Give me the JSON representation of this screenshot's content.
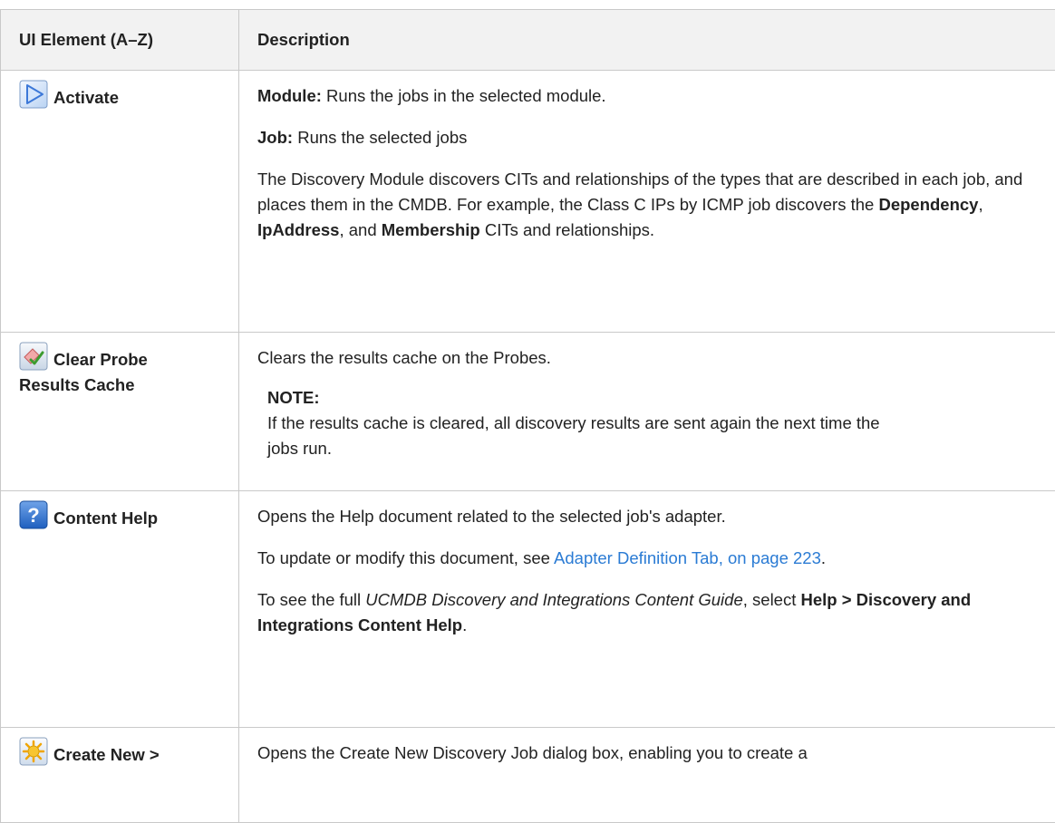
{
  "header": {
    "col1": "UI Element (A–Z)",
    "col2": "Description"
  },
  "rows": [
    {
      "icon": "activate-icon",
      "element": "Activate",
      "desc": {
        "p1_label": "Module:",
        "p1_text": " Runs the jobs in the selected module.",
        "p2_label": "Job:",
        "p2_text": " Runs the selected jobs",
        "p3_a": "The Discovery Module discovers CITs and relationships of the types that are described in each job, and places them in the CMDB. For example, the Class C IPs by ICMP job discovers the ",
        "p3_b1": "Dependency",
        "p3_c": ", ",
        "p3_b2": "IpAddress",
        "p3_d": ", and ",
        "p3_b3": "Membership",
        "p3_e": " CITs and relationships."
      }
    },
    {
      "icon": "clear-cache-icon",
      "element_line1": "Clear Probe",
      "element_line2": "Results Cache",
      "desc": {
        "p1": "Clears the results cache on the Probes.",
        "note_label": "NOTE:",
        "note_text": "If the results cache is cleared, all discovery results are sent again the next time the jobs run."
      }
    },
    {
      "icon": "help-icon",
      "element": "Content Help",
      "desc": {
        "p1": "Opens the Help document related to the selected job's adapter.",
        "p2_a": "To update or modify this document, see ",
        "p2_link": "Adapter Definition Tab, on page 223",
        "p2_b": ".",
        "p3_a": "To see the full ",
        "p3_em": "UCMDB Discovery and Integrations Content Guide",
        "p3_b": ", select ",
        "p3_bold": "Help > Discovery and Integrations Content Help",
        "p3_c": "."
      }
    },
    {
      "icon": "create-new-icon",
      "element": "Create New >",
      "desc": {
        "p1": "Opens the Create New Discovery Job dialog box, enabling you to create a"
      }
    }
  ],
  "colors": {
    "link": "#2a7bd4",
    "border": "#c9c9c9",
    "header_bg": "#f2f2f2"
  }
}
